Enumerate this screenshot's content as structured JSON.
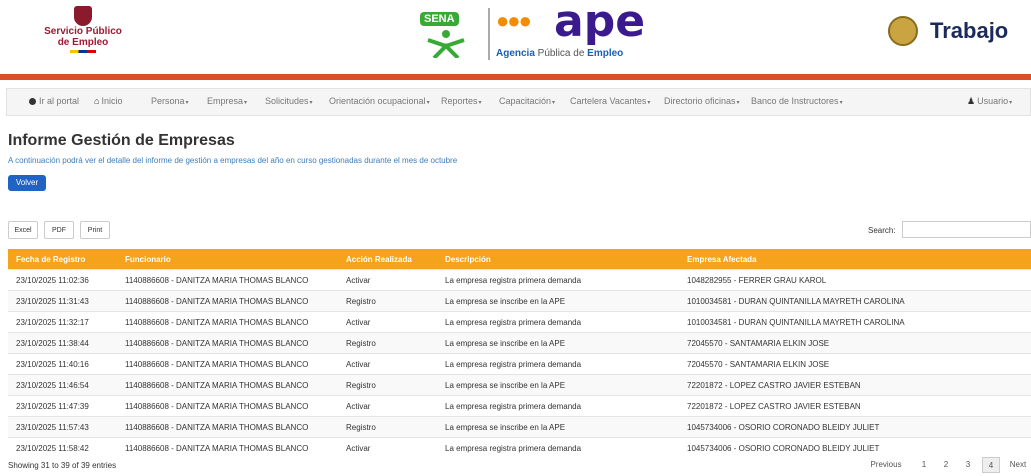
{
  "header": {
    "left_logo_line1": "Servicio Público",
    "left_logo_line2": "de Empleo",
    "sena_label": "SENA",
    "ape_word": "ape",
    "ape_subtitle_pre": "Agencia",
    "ape_subtitle_mid": " Pública de ",
    "ape_subtitle_post": "Empleo",
    "right_logo": "Trabajo"
  },
  "nav": {
    "items": [
      {
        "label": "Ir al portal",
        "caret": false
      },
      {
        "label": "Inicio",
        "caret": false
      },
      {
        "label": "Persona",
        "caret": true
      },
      {
        "label": "Empresa",
        "caret": true
      },
      {
        "label": "Solicitudes",
        "caret": true
      },
      {
        "label": "Orientación ocupacional",
        "caret": true
      },
      {
        "label": "Reportes",
        "caret": true
      },
      {
        "label": "Capacitación",
        "caret": true
      },
      {
        "label": "Cartelera Vacantes",
        "caret": true
      },
      {
        "label": "Directorio oficinas",
        "caret": true
      },
      {
        "label": "Banco de Instructores",
        "caret": true
      }
    ],
    "user_label": "Usuario"
  },
  "page": {
    "title": "Informe Gestión de Empresas",
    "intro": "A continuación podrá ver el detalle del informe de gestión a empresas del año en curso gestionadas durante el mes de octubre",
    "back_button": "Volver"
  },
  "toolbar": {
    "excel": "Excel",
    "pdf": "PDF",
    "print": "Print",
    "search_label": "Search:",
    "search_value": ""
  },
  "table": {
    "columns": [
      "Fecha de Registro",
      "Funcionario",
      "Acción Realizada",
      "Descripción",
      "Empresa Afectada"
    ],
    "rows": [
      [
        "23/10/2025 11:02:36",
        "1140886608 - DANITZA MARIA THOMAS BLANCO",
        "Activar",
        "La empresa registra primera demanda",
        "1048282955 - FERRER GRAU KAROL"
      ],
      [
        "23/10/2025 11:31:43",
        "1140886608 - DANITZA MARIA THOMAS BLANCO",
        "Registro",
        "La empresa se inscribe en la APE",
        "1010034581 - DURAN QUINTANILLA MAYRETH CAROLINA"
      ],
      [
        "23/10/2025 11:32:17",
        "1140886608 - DANITZA MARIA THOMAS BLANCO",
        "Activar",
        "La empresa registra primera demanda",
        "1010034581 - DURAN QUINTANILLA MAYRETH CAROLINA"
      ],
      [
        "23/10/2025 11:38:44",
        "1140886608 - DANITZA MARIA THOMAS BLANCO",
        "Registro",
        "La empresa se inscribe en la APE",
        "72045570 - SANTAMARIA ELKIN JOSE"
      ],
      [
        "23/10/2025 11:40:16",
        "1140886608 - DANITZA MARIA THOMAS BLANCO",
        "Activar",
        "La empresa registra primera demanda",
        "72045570 - SANTAMARIA ELKIN JOSE"
      ],
      [
        "23/10/2025 11:46:54",
        "1140886608 - DANITZA MARIA THOMAS BLANCO",
        "Registro",
        "La empresa se inscribe en la APE",
        "72201872 - LOPEZ CASTRO JAVIER ESTEBAN"
      ],
      [
        "23/10/2025 11:47:39",
        "1140886608 - DANITZA MARIA THOMAS BLANCO",
        "Activar",
        "La empresa registra primera demanda",
        "72201872 - LOPEZ CASTRO JAVIER ESTEBAN"
      ],
      [
        "23/10/2025 11:57:43",
        "1140886608 - DANITZA MARIA THOMAS BLANCO",
        "Registro",
        "La empresa se inscribe en la APE",
        "1045734006 - OSORIO CORONADO BLEIDY JULIET"
      ],
      [
        "23/10/2025 11:58:42",
        "1140886608 - DANITZA MARIA THOMAS BLANCO",
        "Activar",
        "La empresa registra primera demanda",
        "1045734006 - OSORIO CORONADO BLEIDY JULIET"
      ]
    ]
  },
  "footer": {
    "showing": "Showing 31 to 39 of 39 entries",
    "previous": "Previous",
    "pages": [
      "1",
      "2",
      "3",
      "4"
    ],
    "active_page": "4",
    "next": "Next"
  },
  "colors": {
    "accent_bar": "#d9512c",
    "table_header": "#f5a31a",
    "primary_button": "#1f63c6",
    "intro_text": "#3c7ebd"
  }
}
